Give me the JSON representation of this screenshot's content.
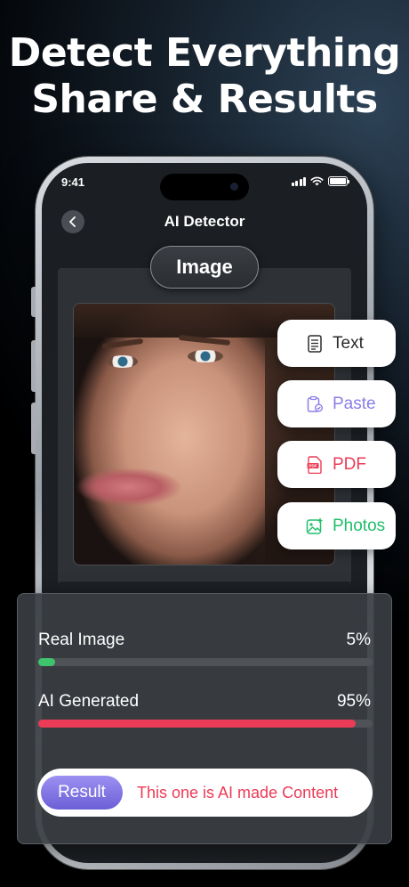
{
  "headline": {
    "line1": "Detect Everything",
    "line2": "Share & Results"
  },
  "status_bar": {
    "time": "9:41"
  },
  "nav": {
    "title": "AI Detector",
    "back_icon": "chevron-left-icon"
  },
  "mode_pill": {
    "label": "Image"
  },
  "options": [
    {
      "label": "Text",
      "icon": "document-icon",
      "color": "#2b2b2b"
    },
    {
      "label": "Paste",
      "icon": "paste-icon",
      "color": "#8a7ee6"
    },
    {
      "label": "PDF",
      "icon": "pdf-icon",
      "color": "#ec3b56"
    },
    {
      "label": "Photos",
      "icon": "photos-icon",
      "color": "#1fbf6a"
    }
  ],
  "results": {
    "real": {
      "label": "Real Image",
      "pct_text": "5%",
      "value": 5,
      "color": "#3ec46d"
    },
    "ai": {
      "label": "AI Generated",
      "pct_text": "95%",
      "value": 95,
      "color": "#ec3b56"
    },
    "result_button": "Result",
    "result_message": "This one is AI made Content"
  }
}
